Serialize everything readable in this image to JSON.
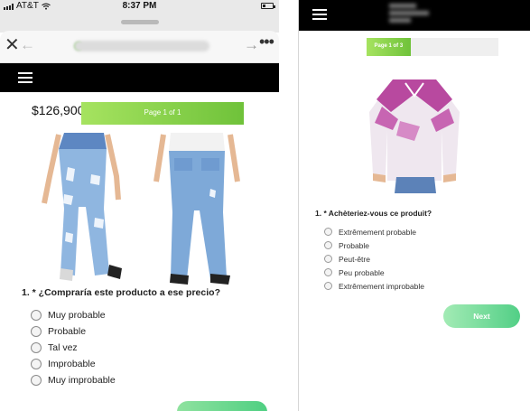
{
  "left_phone": {
    "status_bar": {
      "carrier": "AT&T",
      "time": "8:37 PM"
    },
    "browser": {
      "close_glyph": "✕",
      "back_glyph": "←",
      "forward_glyph": "→",
      "more_glyph": "•••"
    },
    "price": "$126,900.00",
    "progress": {
      "label": "Page 1 of 1",
      "value": 1.0
    },
    "question": "1. * ¿Compraría este producto a ese precio?",
    "options": [
      "Muy probable",
      "Probable",
      "Tal vez",
      "Improbable",
      "Muy improbable"
    ]
  },
  "right_phone": {
    "progress": {
      "label": "Page 1 of 3",
      "value": 0.3333
    },
    "question": "1. * Achèteriez-vous ce produit?",
    "options": [
      "Extrêmement probable",
      "Probable",
      "Peut-être",
      "Peu probable",
      "Extrêmement improbable"
    ],
    "next_label": "Next"
  },
  "colors": {
    "progress_green": "#7ecb40",
    "next_green": "#52cf86",
    "navbar": "#000000"
  }
}
